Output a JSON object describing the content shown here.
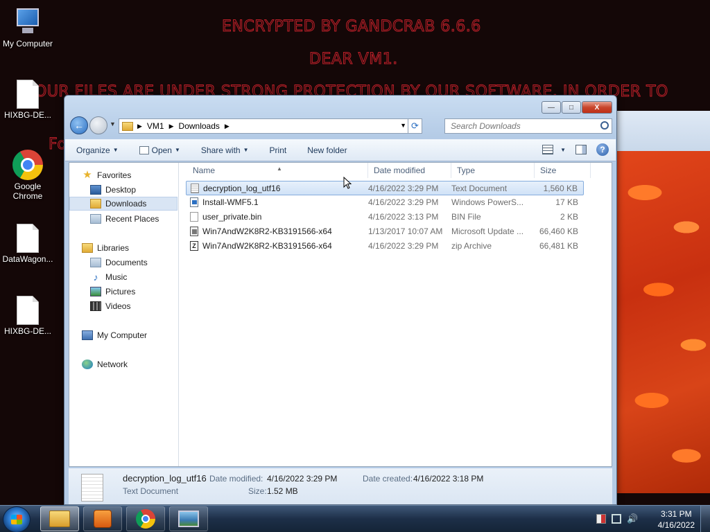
{
  "wallpaper": {
    "line1": "ENCRYPTED BY GANDCRAB 6.6.6",
    "line2": "DEAR VM1.",
    "line3": "OUR FILES ARE UNDER STRONG PROTECTION BY OUR SOFTWARE. IN ORDER TO",
    "line4": "Fo"
  },
  "desktop_icons": [
    {
      "label": "My Computer",
      "icon": "computer-icon"
    },
    {
      "label": "HIXBG-DE...",
      "icon": "document-icon"
    },
    {
      "label": "Google Chrome",
      "icon": "chrome-icon"
    },
    {
      "label": "DataWagon...",
      "icon": "document-icon"
    },
    {
      "label": "HIXBG-DE...",
      "icon": "document-icon"
    }
  ],
  "window": {
    "controls": {
      "minimize": "—",
      "maximize": "□",
      "close": "X"
    },
    "address": {
      "crumbs": [
        "VM1",
        "Downloads"
      ]
    },
    "search": {
      "placeholder": "Search Downloads"
    },
    "toolbar": {
      "organize": "Organize",
      "open": "Open",
      "share_with": "Share with",
      "print": "Print",
      "new_folder": "New folder",
      "help": "?"
    },
    "nav": {
      "favorites": "Favorites",
      "desktop": "Desktop",
      "downloads": "Downloads",
      "recent_places": "Recent Places",
      "libraries": "Libraries",
      "documents": "Documents",
      "music": "Music",
      "pictures": "Pictures",
      "videos": "Videos",
      "my_computer": "My Computer",
      "network": "Network"
    },
    "columns": {
      "name": "Name",
      "date": "Date modified",
      "type": "Type",
      "size": "Size"
    },
    "files": [
      {
        "name": "decryption_log_utf16",
        "date": "4/16/2022 3:29 PM",
        "type": "Text Document",
        "size": "1,560 KB",
        "icon": "text-file-icon",
        "selected": true
      },
      {
        "name": "Install-WMF5.1",
        "date": "4/16/2022 3:29 PM",
        "type": "Windows PowerS...",
        "size": "17 KB",
        "icon": "powershell-file-icon"
      },
      {
        "name": "user_private.bin",
        "date": "4/16/2022 3:13 PM",
        "type": "BIN File",
        "size": "2 KB",
        "icon": "bin-file-icon"
      },
      {
        "name": "Win7AndW2K8R2-KB3191566-x64",
        "date": "1/13/2017 10:07 AM",
        "type": "Microsoft Update ...",
        "size": "66,460 KB",
        "icon": "msu-file-icon"
      },
      {
        "name": "Win7AndW2K8R2-KB3191566-x64",
        "date": "4/16/2022 3:29 PM",
        "type": "zip Archive",
        "size": "66,481 KB",
        "icon": "zip-file-icon"
      }
    ],
    "details": {
      "name": "decryption_log_utf16",
      "kind": "Text Document",
      "date_modified_label": "Date modified:",
      "date_modified": "4/16/2022 3:29 PM",
      "date_created_label": "Date created:",
      "date_created": "4/16/2022 3:18 PM",
      "size_label": "Size:",
      "size": "1.52 MB"
    }
  },
  "taskbar": {
    "clock_time": "3:31 PM",
    "clock_date": "4/16/2022"
  }
}
